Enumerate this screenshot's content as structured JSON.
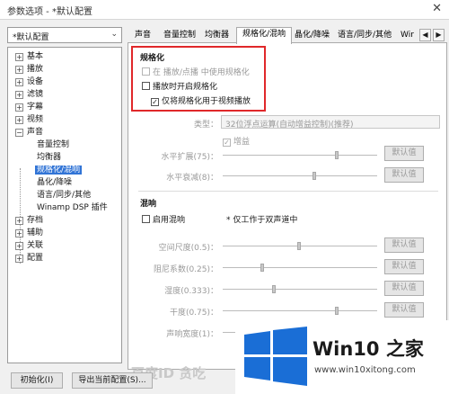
{
  "window": {
    "title": "参数选项 - *默认配置",
    "close_glyph": "✕"
  },
  "preset": {
    "value": "*默认配置",
    "arrow": "⌄"
  },
  "tree": {
    "items": [
      {
        "label": "基本",
        "toggle": "+"
      },
      {
        "label": "播放",
        "toggle": "+"
      },
      {
        "label": "设备",
        "toggle": "+"
      },
      {
        "label": "滤镜",
        "toggle": "+"
      },
      {
        "label": "字幕",
        "toggle": "+"
      },
      {
        "label": "视频",
        "toggle": "+"
      },
      {
        "label": "声音",
        "toggle": "−"
      },
      {
        "label": "音量控制"
      },
      {
        "label": "均衡器"
      },
      {
        "label": "规格化/混响",
        "selected": true
      },
      {
        "label": "晶化/降噪"
      },
      {
        "label": "语言/同步/其他"
      },
      {
        "label": "Winamp DSP 插件"
      },
      {
        "label": "存档",
        "toggle": "+"
      },
      {
        "label": "辅助",
        "toggle": "+"
      },
      {
        "label": "关联",
        "toggle": "+"
      },
      {
        "label": "配置",
        "toggle": "+"
      }
    ]
  },
  "tabs": {
    "items": [
      "声音",
      "音量控制",
      "均衡器",
      "规格化/混响",
      "晶化/降噪",
      "语言/同步/其他",
      "Wir"
    ],
    "active_index": 3,
    "prev_glyph": "◀",
    "next_glyph": "▶"
  },
  "normalize": {
    "title": "规格化",
    "in_playlist": {
      "label": "在 播放/点播 中使用规格化",
      "checked": false,
      "enabled": false
    },
    "on_play": {
      "label": "播放时开启规格化",
      "checked": false
    },
    "video_only": {
      "label": "仅将规格化用于视频播放",
      "checked": true
    },
    "type_label": "类型：",
    "type_value": "32位浮点运算(自动增益控制)(推荐)",
    "gain": {
      "label": "增益",
      "checked": true
    },
    "h_expand": {
      "label": "水平扩展(75)：",
      "button": "默认值",
      "level": 0.75
    },
    "h_decay": {
      "label": "水平衰减(8)：",
      "button": "默认值",
      "level": 0.6
    }
  },
  "reverb": {
    "title": "混响",
    "enable": {
      "label": "启用混响",
      "checked": false
    },
    "note": "* 仅工作于双声道中",
    "params": [
      {
        "label": "空间尺度(0.5)：",
        "button": "默认值",
        "level": 0.5
      },
      {
        "label": "阻尼系数(0.25)：",
        "button": "默认值",
        "level": 0.25
      },
      {
        "label": "湿度(0.333)：",
        "button": "默认值",
        "level": 0.33
      },
      {
        "label": "干度(0.75)：",
        "button": "默认值",
        "level": 0.75
      },
      {
        "label": "声响宽度(1)：",
        "button": "",
        "level": 1.0
      }
    ]
  },
  "footer": {
    "init_button": "初始化(I)",
    "export_button": "导出当前配置(S)..."
  },
  "watermark": {
    "baidu_text": "百度ID 贪吃",
    "brand": "Win10 之家",
    "url": "www.win10xitong.com",
    "logo_color": "#1a6ed6"
  }
}
